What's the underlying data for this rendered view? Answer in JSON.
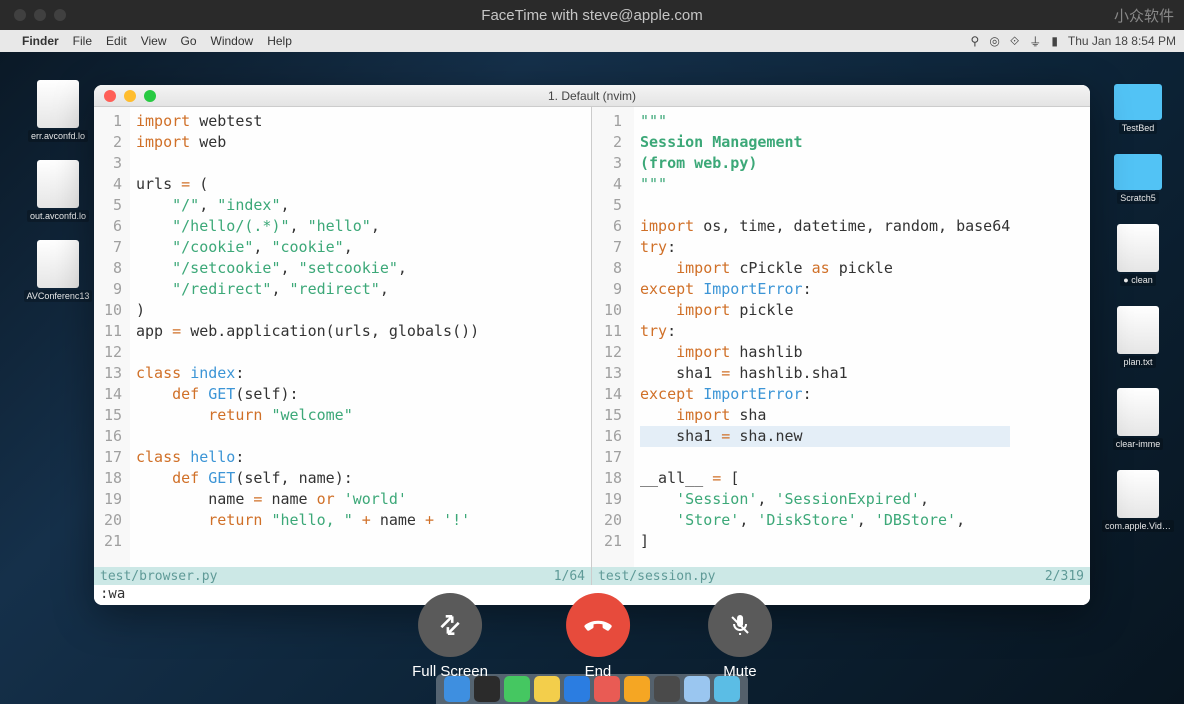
{
  "facetime": {
    "title": "FaceTime with steve@apple.com",
    "watermark": "小众软件",
    "controls": {
      "fullscreen": "Full Screen",
      "end": "End",
      "mute": "Mute"
    }
  },
  "menubar": {
    "app": "Finder",
    "items": [
      "File",
      "Edit",
      "View",
      "Go",
      "Window",
      "Help"
    ],
    "datetime": "Thu Jan 18  8:54 PM"
  },
  "desktop_left": [
    "err.avconfd.lo",
    "out.avconfd.lo",
    "AVConferenc13"
  ],
  "desktop_right": [
    "TestBed",
    "Scratch5",
    "● clean",
    "plan.txt",
    "clear-imme",
    "com.apple.VideoConference.plist"
  ],
  "terminal": {
    "title": "1. Default (nvim)",
    "command": ":wa",
    "left": {
      "status_file": "test/browser.py",
      "status_pos": "1/64",
      "lines": [
        {
          "n": 1,
          "tokens": [
            [
              "kw",
              "import"
            ],
            [
              "sp",
              " "
            ],
            [
              "name",
              "webtest"
            ]
          ]
        },
        {
          "n": 2,
          "tokens": [
            [
              "kw",
              "import"
            ],
            [
              "sp",
              " "
            ],
            [
              "name",
              "web"
            ]
          ]
        },
        {
          "n": 3,
          "tokens": []
        },
        {
          "n": 4,
          "tokens": [
            [
              "name",
              "urls "
            ],
            [
              "op",
              "="
            ],
            [
              "sp",
              " "
            ],
            [
              "paren",
              "("
            ]
          ]
        },
        {
          "n": 5,
          "tokens": [
            [
              "sp",
              "    "
            ],
            [
              "str",
              "\"/\""
            ],
            [
              "paren",
              ", "
            ],
            [
              "str",
              "\"index\""
            ],
            [
              "paren",
              ","
            ]
          ]
        },
        {
          "n": 6,
          "tokens": [
            [
              "sp",
              "    "
            ],
            [
              "str",
              "\"/hello/(.*)\""
            ],
            [
              "paren",
              ", "
            ],
            [
              "str",
              "\"hello\""
            ],
            [
              "paren",
              ","
            ]
          ]
        },
        {
          "n": 7,
          "tokens": [
            [
              "sp",
              "    "
            ],
            [
              "str",
              "\"/cookie\""
            ],
            [
              "paren",
              ", "
            ],
            [
              "str",
              "\"cookie\""
            ],
            [
              "paren",
              ","
            ]
          ]
        },
        {
          "n": 8,
          "tokens": [
            [
              "sp",
              "    "
            ],
            [
              "str",
              "\"/setcookie\""
            ],
            [
              "paren",
              ", "
            ],
            [
              "str",
              "\"setcookie\""
            ],
            [
              "paren",
              ","
            ]
          ]
        },
        {
          "n": 9,
          "tokens": [
            [
              "sp",
              "    "
            ],
            [
              "str",
              "\"/redirect\""
            ],
            [
              "paren",
              ", "
            ],
            [
              "str",
              "\"redirect\""
            ],
            [
              "paren",
              ","
            ]
          ]
        },
        {
          "n": 10,
          "tokens": [
            [
              "paren",
              ")"
            ]
          ]
        },
        {
          "n": 11,
          "tokens": [
            [
              "name",
              "app "
            ],
            [
              "op",
              "="
            ],
            [
              "sp",
              " "
            ],
            [
              "name",
              "web.application"
            ],
            [
              "paren",
              "("
            ],
            [
              "name",
              "urls"
            ],
            [
              "paren",
              ", "
            ],
            [
              "name",
              "globals"
            ],
            [
              "paren",
              "())"
            ]
          ]
        },
        {
          "n": 12,
          "tokens": []
        },
        {
          "n": 13,
          "tokens": [
            [
              "kw",
              "class"
            ],
            [
              "sp",
              " "
            ],
            [
              "builtin",
              "index"
            ],
            [
              "paren",
              ":"
            ]
          ]
        },
        {
          "n": 14,
          "tokens": [
            [
              "sp",
              "    "
            ],
            [
              "kw",
              "def"
            ],
            [
              "sp",
              " "
            ],
            [
              "builtin",
              "GET"
            ],
            [
              "paren",
              "("
            ],
            [
              "name",
              "self"
            ],
            [
              "paren",
              "):"
            ]
          ]
        },
        {
          "n": 15,
          "tokens": [
            [
              "sp",
              "        "
            ],
            [
              "kw",
              "return"
            ],
            [
              "sp",
              " "
            ],
            [
              "str",
              "\"welcome\""
            ]
          ]
        },
        {
          "n": 16,
          "tokens": []
        },
        {
          "n": 17,
          "tokens": [
            [
              "kw",
              "class"
            ],
            [
              "sp",
              " "
            ],
            [
              "builtin",
              "hello"
            ],
            [
              "paren",
              ":"
            ]
          ]
        },
        {
          "n": 18,
          "tokens": [
            [
              "sp",
              "    "
            ],
            [
              "kw",
              "def"
            ],
            [
              "sp",
              " "
            ],
            [
              "builtin",
              "GET"
            ],
            [
              "paren",
              "("
            ],
            [
              "name",
              "self"
            ],
            [
              "paren",
              ", "
            ],
            [
              "name",
              "name"
            ],
            [
              "paren",
              "):"
            ]
          ]
        },
        {
          "n": 19,
          "tokens": [
            [
              "sp",
              "        "
            ],
            [
              "name",
              "name "
            ],
            [
              "op",
              "="
            ],
            [
              "sp",
              " "
            ],
            [
              "name",
              "name "
            ],
            [
              "kw",
              "or"
            ],
            [
              "sp",
              " "
            ],
            [
              "str",
              "'world'"
            ]
          ]
        },
        {
          "n": 20,
          "tokens": [
            [
              "sp",
              "        "
            ],
            [
              "kw",
              "return"
            ],
            [
              "sp",
              " "
            ],
            [
              "str",
              "\"hello, \""
            ],
            [
              "sp",
              " "
            ],
            [
              "op",
              "+"
            ],
            [
              "sp",
              " "
            ],
            [
              "name",
              "name "
            ],
            [
              "op",
              "+"
            ],
            [
              "sp",
              " "
            ],
            [
              "str",
              "'!'"
            ]
          ]
        },
        {
          "n": 21,
          "tokens": []
        }
      ]
    },
    "right": {
      "status_file": "test/session.py",
      "status_pos": "2/319",
      "lines": [
        {
          "n": 1,
          "tokens": [
            [
              "str",
              "\"\"\""
            ]
          ]
        },
        {
          "n": 2,
          "tokens": [
            [
              "doc",
              "Session Management"
            ]
          ]
        },
        {
          "n": 3,
          "tokens": [
            [
              "doc",
              "(from web.py)"
            ]
          ]
        },
        {
          "n": 4,
          "tokens": [
            [
              "str",
              "\"\"\""
            ]
          ]
        },
        {
          "n": 5,
          "tokens": []
        },
        {
          "n": 6,
          "tokens": [
            [
              "kw",
              "import"
            ],
            [
              "sp",
              " "
            ],
            [
              "name",
              "os"
            ],
            [
              "paren",
              ", "
            ],
            [
              "name",
              "time"
            ],
            [
              "paren",
              ", "
            ],
            [
              "name",
              "datetime"
            ],
            [
              "paren",
              ", "
            ],
            [
              "name",
              "random"
            ],
            [
              "paren",
              ", "
            ],
            [
              "name",
              "base64"
            ]
          ]
        },
        {
          "n": 7,
          "tokens": [
            [
              "kw",
              "try"
            ],
            [
              "paren",
              ":"
            ]
          ]
        },
        {
          "n": 8,
          "tokens": [
            [
              "sp",
              "    "
            ],
            [
              "kw",
              "import"
            ],
            [
              "sp",
              " "
            ],
            [
              "name",
              "cPickle "
            ],
            [
              "kw",
              "as"
            ],
            [
              "sp",
              " "
            ],
            [
              "name",
              "pickle"
            ]
          ]
        },
        {
          "n": 9,
          "tokens": [
            [
              "kw",
              "except"
            ],
            [
              "sp",
              " "
            ],
            [
              "builtin",
              "ImportError"
            ],
            [
              "paren",
              ":"
            ]
          ]
        },
        {
          "n": 10,
          "tokens": [
            [
              "sp",
              "    "
            ],
            [
              "kw",
              "import"
            ],
            [
              "sp",
              " "
            ],
            [
              "name",
              "pickle"
            ]
          ]
        },
        {
          "n": 11,
          "tokens": [
            [
              "kw",
              "try"
            ],
            [
              "paren",
              ":"
            ]
          ]
        },
        {
          "n": 12,
          "tokens": [
            [
              "sp",
              "    "
            ],
            [
              "kw",
              "import"
            ],
            [
              "sp",
              " "
            ],
            [
              "name",
              "hashlib"
            ]
          ]
        },
        {
          "n": 13,
          "tokens": [
            [
              "sp",
              "    "
            ],
            [
              "name",
              "sha1 "
            ],
            [
              "op",
              "="
            ],
            [
              "sp",
              " "
            ],
            [
              "name",
              "hashlib.sha1"
            ]
          ]
        },
        {
          "n": 14,
          "tokens": [
            [
              "kw",
              "except"
            ],
            [
              "sp",
              " "
            ],
            [
              "builtin",
              "ImportError"
            ],
            [
              "paren",
              ":"
            ]
          ]
        },
        {
          "n": 15,
          "tokens": [
            [
              "sp",
              "    "
            ],
            [
              "kw",
              "import"
            ],
            [
              "sp",
              " "
            ],
            [
              "name",
              "sha"
            ]
          ]
        },
        {
          "n": 16,
          "hl": true,
          "tokens": [
            [
              "sp",
              "    "
            ],
            [
              "name",
              "sha1 "
            ],
            [
              "op",
              "="
            ],
            [
              "sp",
              " "
            ],
            [
              "name",
              "sha.new "
            ]
          ]
        },
        {
          "n": 17,
          "tokens": []
        },
        {
          "n": 18,
          "tokens": [
            [
              "name",
              "__all__ "
            ],
            [
              "op",
              "="
            ],
            [
              "sp",
              " "
            ],
            [
              "paren",
              "["
            ]
          ]
        },
        {
          "n": 19,
          "tokens": [
            [
              "sp",
              "    "
            ],
            [
              "str",
              "'Session'"
            ],
            [
              "paren",
              ", "
            ],
            [
              "str",
              "'SessionExpired'"
            ],
            [
              "paren",
              ","
            ]
          ]
        },
        {
          "n": 20,
          "tokens": [
            [
              "sp",
              "    "
            ],
            [
              "str",
              "'Store'"
            ],
            [
              "paren",
              ", "
            ],
            [
              "str",
              "'DiskStore'"
            ],
            [
              "paren",
              ", "
            ],
            [
              "str",
              "'DBStore'"
            ],
            [
              "paren",
              ","
            ]
          ]
        },
        {
          "n": 21,
          "tokens": [
            [
              "paren",
              "]"
            ]
          ]
        }
      ]
    }
  },
  "dock_colors": [
    "#3e8fe0",
    "#2b2b2b",
    "#45c761",
    "#f3ce4b",
    "#2b7de1",
    "#e95b54",
    "#f5a623",
    "#4a4a4a",
    "#9ac6f0",
    "#5bbde5"
  ]
}
